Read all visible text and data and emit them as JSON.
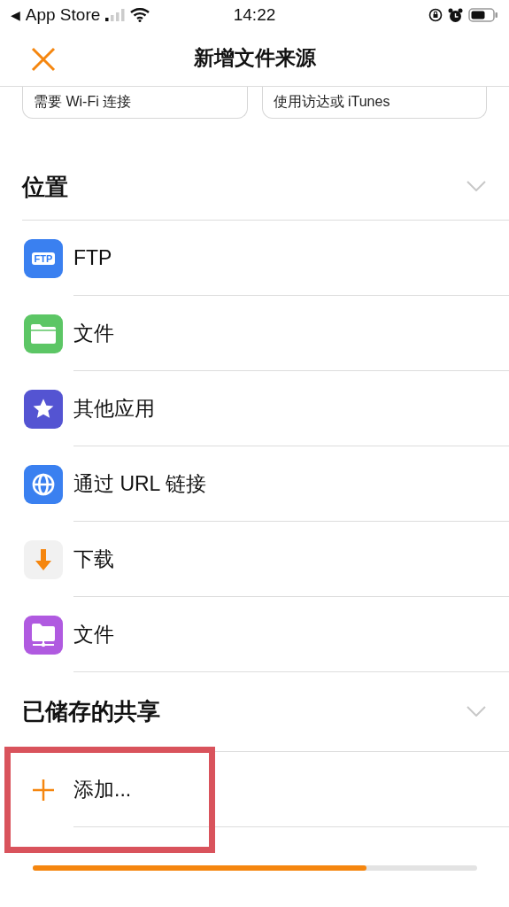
{
  "status_bar": {
    "back_arrow": "◀",
    "back_label": "App Store",
    "time": "14:22"
  },
  "nav": {
    "title": "新增文件来源"
  },
  "cards": [
    {
      "text": "需要 Wi-Fi 连接"
    },
    {
      "text": "使用访达或 iTunes"
    }
  ],
  "sections": [
    {
      "title": "位置",
      "items": [
        {
          "kind": "ftp",
          "label": "FTP",
          "badge": "FTP"
        },
        {
          "kind": "folder",
          "label": "文件"
        },
        {
          "kind": "star",
          "label": "其他应用"
        },
        {
          "kind": "globe",
          "label": "通过 URL 链接"
        },
        {
          "kind": "download",
          "label": "下载"
        },
        {
          "kind": "network",
          "label": "文件"
        }
      ]
    },
    {
      "title": "已储存的共享",
      "items": [
        {
          "kind": "add",
          "label": "添加...",
          "highlighted": true
        }
      ]
    }
  ],
  "progress": {
    "level": 0.75
  }
}
